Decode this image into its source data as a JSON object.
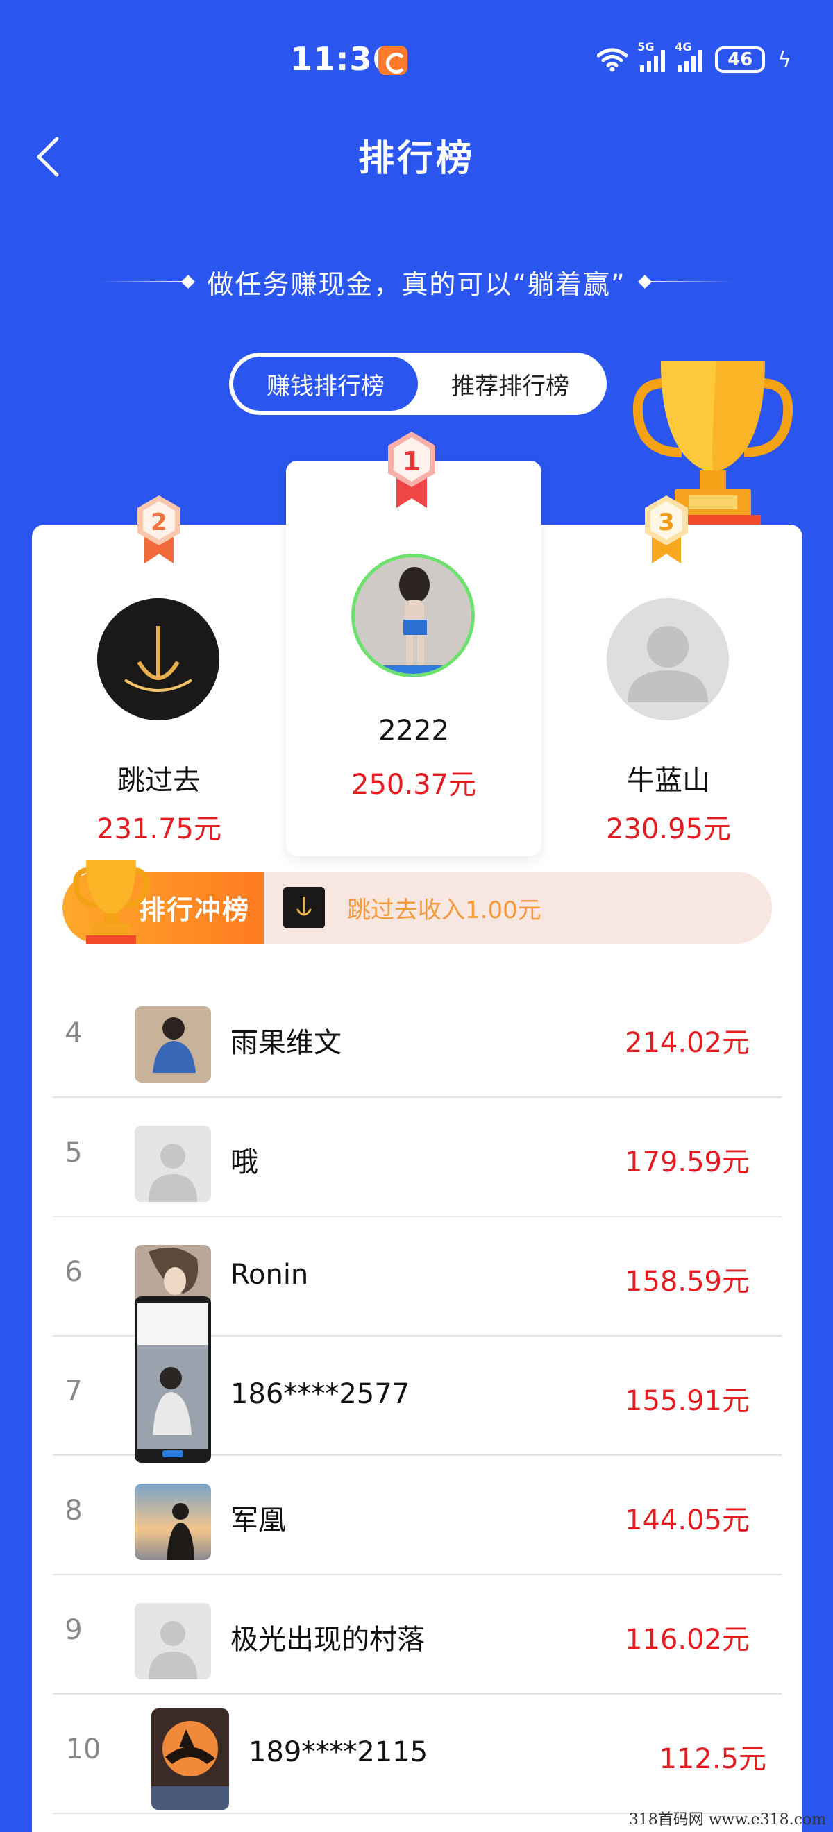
{
  "status_bar": {
    "time": "11:36",
    "network_1": "5G",
    "network_2": "4G",
    "battery": "46"
  },
  "header": {
    "title": "排行榜",
    "slogan": "做任务赚现金，真的可以“躺着赢”"
  },
  "tabs": [
    {
      "label": "赚钱排行榜",
      "active": true
    },
    {
      "label": "推荐排行榜",
      "active": false
    }
  ],
  "podium": {
    "first": {
      "rank": "1",
      "name": "2222",
      "amount": "250.37元"
    },
    "second": {
      "rank": "2",
      "name": "跳过去",
      "amount": "231.75元"
    },
    "third": {
      "rank": "3",
      "name": "牛蓝山",
      "amount": "230.95元"
    }
  },
  "ticker": {
    "badge": "排行冲榜",
    "message": "跳过去收入1.00元"
  },
  "list": [
    {
      "rank": "4",
      "name": "雨果维文",
      "amount": "214.02元"
    },
    {
      "rank": "5",
      "name": "哦",
      "amount": "179.59元"
    },
    {
      "rank": "6",
      "name": "Ronin",
      "amount": "158.59元"
    },
    {
      "rank": "7",
      "name": "186****2577",
      "amount": "155.91元"
    },
    {
      "rank": "8",
      "name": "军凰",
      "amount": "144.05元"
    },
    {
      "rank": "9",
      "name": "极光出现的村落",
      "amount": "116.02元"
    },
    {
      "rank": "10",
      "name": "189****2115",
      "amount": "112.5元"
    }
  ],
  "watermark": "318首码网 www.e318.com",
  "colors": {
    "background_blue": "#2a55ee",
    "amount_red": "#e31c22",
    "ticker_orange": "#f39a3b"
  }
}
